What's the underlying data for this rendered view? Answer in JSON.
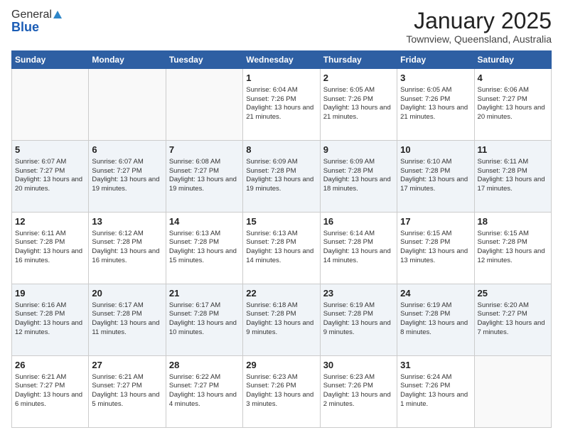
{
  "header": {
    "logo_general": "General",
    "logo_blue": "Blue",
    "month": "January 2025",
    "location": "Townview, Queensland, Australia"
  },
  "weekdays": [
    "Sunday",
    "Monday",
    "Tuesday",
    "Wednesday",
    "Thursday",
    "Friday",
    "Saturday"
  ],
  "weeks": [
    [
      {
        "day": "",
        "sunrise": "",
        "sunset": "",
        "daylight": ""
      },
      {
        "day": "",
        "sunrise": "",
        "sunset": "",
        "daylight": ""
      },
      {
        "day": "",
        "sunrise": "",
        "sunset": "",
        "daylight": ""
      },
      {
        "day": "1",
        "sunrise": "Sunrise: 6:04 AM",
        "sunset": "Sunset: 7:26 PM",
        "daylight": "Daylight: 13 hours and 21 minutes."
      },
      {
        "day": "2",
        "sunrise": "Sunrise: 6:05 AM",
        "sunset": "Sunset: 7:26 PM",
        "daylight": "Daylight: 13 hours and 21 minutes."
      },
      {
        "day": "3",
        "sunrise": "Sunrise: 6:05 AM",
        "sunset": "Sunset: 7:26 PM",
        "daylight": "Daylight: 13 hours and 21 minutes."
      },
      {
        "day": "4",
        "sunrise": "Sunrise: 6:06 AM",
        "sunset": "Sunset: 7:27 PM",
        "daylight": "Daylight: 13 hours and 20 minutes."
      }
    ],
    [
      {
        "day": "5",
        "sunrise": "Sunrise: 6:07 AM",
        "sunset": "Sunset: 7:27 PM",
        "daylight": "Daylight: 13 hours and 20 minutes."
      },
      {
        "day": "6",
        "sunrise": "Sunrise: 6:07 AM",
        "sunset": "Sunset: 7:27 PM",
        "daylight": "Daylight: 13 hours and 19 minutes."
      },
      {
        "day": "7",
        "sunrise": "Sunrise: 6:08 AM",
        "sunset": "Sunset: 7:27 PM",
        "daylight": "Daylight: 13 hours and 19 minutes."
      },
      {
        "day": "8",
        "sunrise": "Sunrise: 6:09 AM",
        "sunset": "Sunset: 7:28 PM",
        "daylight": "Daylight: 13 hours and 19 minutes."
      },
      {
        "day": "9",
        "sunrise": "Sunrise: 6:09 AM",
        "sunset": "Sunset: 7:28 PM",
        "daylight": "Daylight: 13 hours and 18 minutes."
      },
      {
        "day": "10",
        "sunrise": "Sunrise: 6:10 AM",
        "sunset": "Sunset: 7:28 PM",
        "daylight": "Daylight: 13 hours and 17 minutes."
      },
      {
        "day": "11",
        "sunrise": "Sunrise: 6:11 AM",
        "sunset": "Sunset: 7:28 PM",
        "daylight": "Daylight: 13 hours and 17 minutes."
      }
    ],
    [
      {
        "day": "12",
        "sunrise": "Sunrise: 6:11 AM",
        "sunset": "Sunset: 7:28 PM",
        "daylight": "Daylight: 13 hours and 16 minutes."
      },
      {
        "day": "13",
        "sunrise": "Sunrise: 6:12 AM",
        "sunset": "Sunset: 7:28 PM",
        "daylight": "Daylight: 13 hours and 16 minutes."
      },
      {
        "day": "14",
        "sunrise": "Sunrise: 6:13 AM",
        "sunset": "Sunset: 7:28 PM",
        "daylight": "Daylight: 13 hours and 15 minutes."
      },
      {
        "day": "15",
        "sunrise": "Sunrise: 6:13 AM",
        "sunset": "Sunset: 7:28 PM",
        "daylight": "Daylight: 13 hours and 14 minutes."
      },
      {
        "day": "16",
        "sunrise": "Sunrise: 6:14 AM",
        "sunset": "Sunset: 7:28 PM",
        "daylight": "Daylight: 13 hours and 14 minutes."
      },
      {
        "day": "17",
        "sunrise": "Sunrise: 6:15 AM",
        "sunset": "Sunset: 7:28 PM",
        "daylight": "Daylight: 13 hours and 13 minutes."
      },
      {
        "day": "18",
        "sunrise": "Sunrise: 6:15 AM",
        "sunset": "Sunset: 7:28 PM",
        "daylight": "Daylight: 13 hours and 12 minutes."
      }
    ],
    [
      {
        "day": "19",
        "sunrise": "Sunrise: 6:16 AM",
        "sunset": "Sunset: 7:28 PM",
        "daylight": "Daylight: 13 hours and 12 minutes."
      },
      {
        "day": "20",
        "sunrise": "Sunrise: 6:17 AM",
        "sunset": "Sunset: 7:28 PM",
        "daylight": "Daylight: 13 hours and 11 minutes."
      },
      {
        "day": "21",
        "sunrise": "Sunrise: 6:17 AM",
        "sunset": "Sunset: 7:28 PM",
        "daylight": "Daylight: 13 hours and 10 minutes."
      },
      {
        "day": "22",
        "sunrise": "Sunrise: 6:18 AM",
        "sunset": "Sunset: 7:28 PM",
        "daylight": "Daylight: 13 hours and 9 minutes."
      },
      {
        "day": "23",
        "sunrise": "Sunrise: 6:19 AM",
        "sunset": "Sunset: 7:28 PM",
        "daylight": "Daylight: 13 hours and 9 minutes."
      },
      {
        "day": "24",
        "sunrise": "Sunrise: 6:19 AM",
        "sunset": "Sunset: 7:28 PM",
        "daylight": "Daylight: 13 hours and 8 minutes."
      },
      {
        "day": "25",
        "sunrise": "Sunrise: 6:20 AM",
        "sunset": "Sunset: 7:27 PM",
        "daylight": "Daylight: 13 hours and 7 minutes."
      }
    ],
    [
      {
        "day": "26",
        "sunrise": "Sunrise: 6:21 AM",
        "sunset": "Sunset: 7:27 PM",
        "daylight": "Daylight: 13 hours and 6 minutes."
      },
      {
        "day": "27",
        "sunrise": "Sunrise: 6:21 AM",
        "sunset": "Sunset: 7:27 PM",
        "daylight": "Daylight: 13 hours and 5 minutes."
      },
      {
        "day": "28",
        "sunrise": "Sunrise: 6:22 AM",
        "sunset": "Sunset: 7:27 PM",
        "daylight": "Daylight: 13 hours and 4 minutes."
      },
      {
        "day": "29",
        "sunrise": "Sunrise: 6:23 AM",
        "sunset": "Sunset: 7:26 PM",
        "daylight": "Daylight: 13 hours and 3 minutes."
      },
      {
        "day": "30",
        "sunrise": "Sunrise: 6:23 AM",
        "sunset": "Sunset: 7:26 PM",
        "daylight": "Daylight: 13 hours and 2 minutes."
      },
      {
        "day": "31",
        "sunrise": "Sunrise: 6:24 AM",
        "sunset": "Sunset: 7:26 PM",
        "daylight": "Daylight: 13 hours and 1 minute."
      },
      {
        "day": "",
        "sunrise": "",
        "sunset": "",
        "daylight": ""
      }
    ]
  ]
}
